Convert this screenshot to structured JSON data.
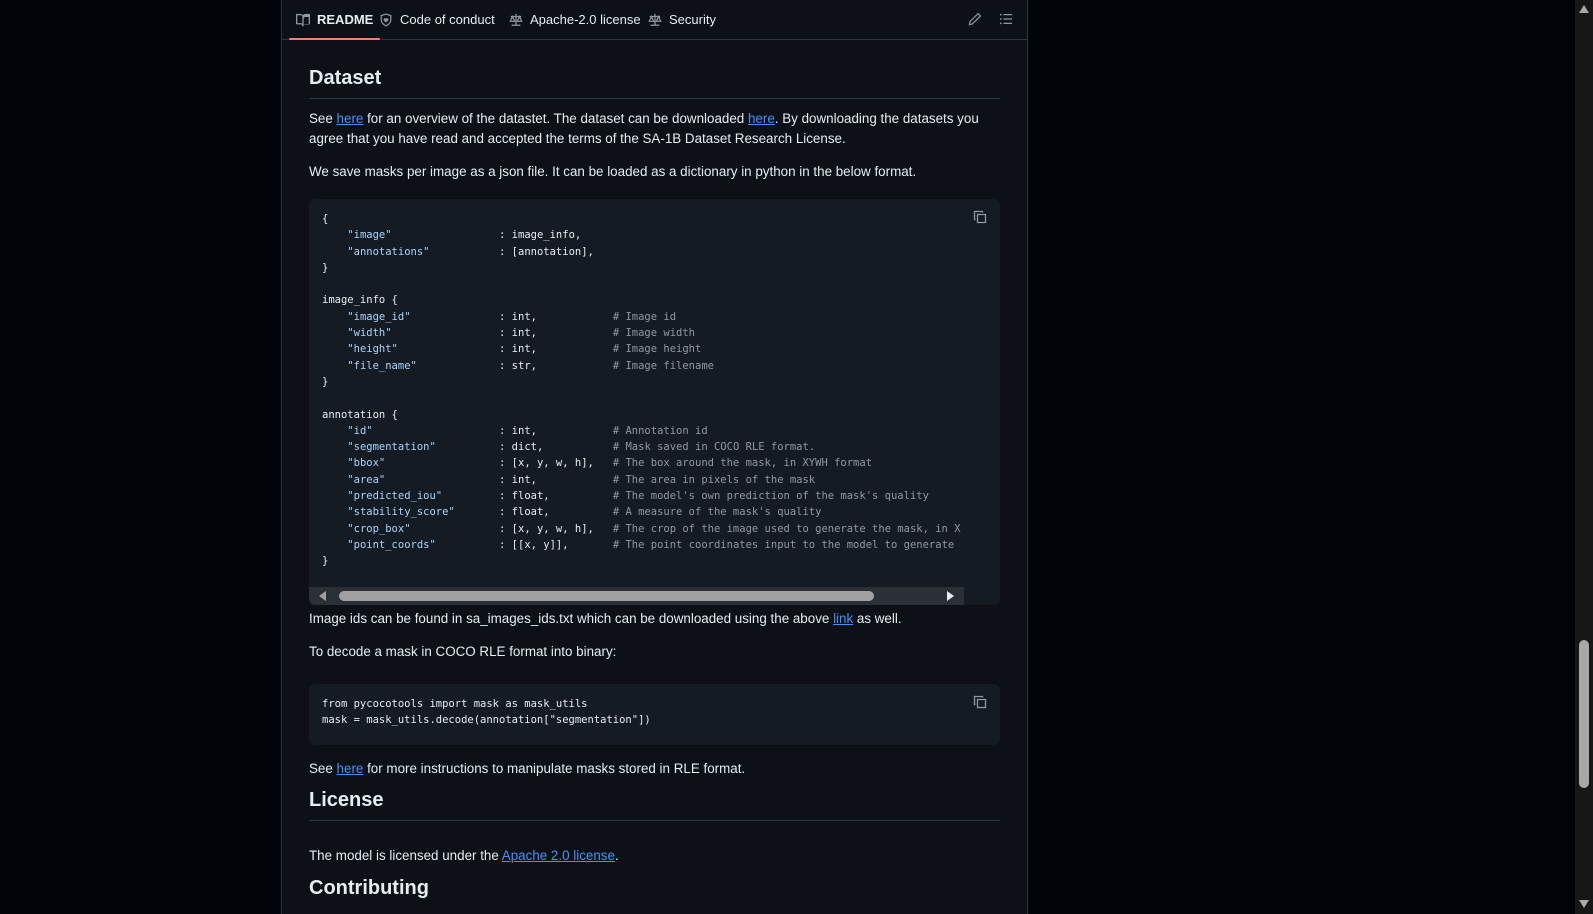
{
  "tabs": [
    {
      "label": "README",
      "icon": "book-icon"
    },
    {
      "label": "Code of conduct",
      "icon": "heart-shield-icon"
    },
    {
      "label": "Apache-2.0 license",
      "icon": "law-icon"
    },
    {
      "label": "Security",
      "icon": "law-icon"
    }
  ],
  "toolbar": {
    "edit_icon": "pencil-icon",
    "outline_icon": "list-icon"
  },
  "dataset": {
    "heading": "Dataset",
    "p1": {
      "a": "See ",
      "link1": "here",
      "b": " for an overview of the datastet. The dataset can be downloaded ",
      "link2": "here",
      "c": ". By downloading the datasets you agree that you have read and accepted the terms of the SA-1B Dataset Research License."
    },
    "p2": "We save masks per image as a json file. It can be loaded as a dictionary in python in the below format.",
    "p3": {
      "a": "Image ids can be found in sa_images_ids.txt which can be downloaded using the above ",
      "link": "link",
      "b": " as well."
    },
    "p4": "To decode a mask in COCO RLE format into binary:",
    "p5": {
      "a": "See ",
      "link": "here",
      "b": " for more instructions to manipulate masks stored in RLE format."
    }
  },
  "code1": {
    "lines": [
      {
        "t": "{"
      },
      {
        "k": "\"image\"",
        "v": ": image_info,"
      },
      {
        "k": "\"annotations\"",
        "v": ": [annotation],"
      },
      {
        "t": "}"
      },
      {
        "t": ""
      },
      {
        "t": "image_info {"
      },
      {
        "k": "\"image_id\"",
        "v": ": int,",
        "c": "# Image id"
      },
      {
        "k": "\"width\"",
        "v": ": int,",
        "c": "# Image width"
      },
      {
        "k": "\"height\"",
        "v": ": int,",
        "c": "# Image height"
      },
      {
        "k": "\"file_name\"",
        "v": ": str,",
        "c": "# Image filename"
      },
      {
        "t": "}"
      },
      {
        "t": ""
      },
      {
        "t": "annotation {"
      },
      {
        "k": "\"id\"",
        "v": ": int,",
        "c": "# Annotation id"
      },
      {
        "k": "\"segmentation\"",
        "v": ": dict,",
        "c": "# Mask saved in COCO RLE format."
      },
      {
        "k": "\"bbox\"",
        "v": ": [x, y, w, h],",
        "c": "# The box around the mask, in XYWH format"
      },
      {
        "k": "\"area\"",
        "v": ": int,",
        "c": "# The area in pixels of the mask"
      },
      {
        "k": "\"predicted_iou\"",
        "v": ": float,",
        "c": "# The model's own prediction of the mask's quality"
      },
      {
        "k": "\"stability_score\"",
        "v": ": float,",
        "c": "# A measure of the mask's quality"
      },
      {
        "k": "\"crop_box\"",
        "v": ": [x, y, w, h],",
        "c": "# The crop of the image used to generate the mask, in X"
      },
      {
        "k": "\"point_coords\"",
        "v": ": [[x, y]],",
        "c": "# The point coordinates input to the model to generate"
      },
      {
        "t": "}"
      }
    ]
  },
  "code2": {
    "line1": "from pycocotools import mask as mask_utils",
    "line2": "mask = mask_utils.decode(annotation[\"segmentation\"])"
  },
  "license": {
    "heading": "License",
    "p": {
      "a": "The model is licensed under the ",
      "link": "Apache 2.0 license",
      "b": "."
    }
  },
  "contributing": {
    "heading": "Contributing"
  },
  "icons": {
    "copy": "copy-icon",
    "scroll_left": "arrow-left-icon",
    "scroll_right": "arrow-right-icon"
  },
  "colors": {
    "accent": "#f78166",
    "link": "#4493f8",
    "string": "#a5d6ff",
    "comment": "#9198a1"
  }
}
